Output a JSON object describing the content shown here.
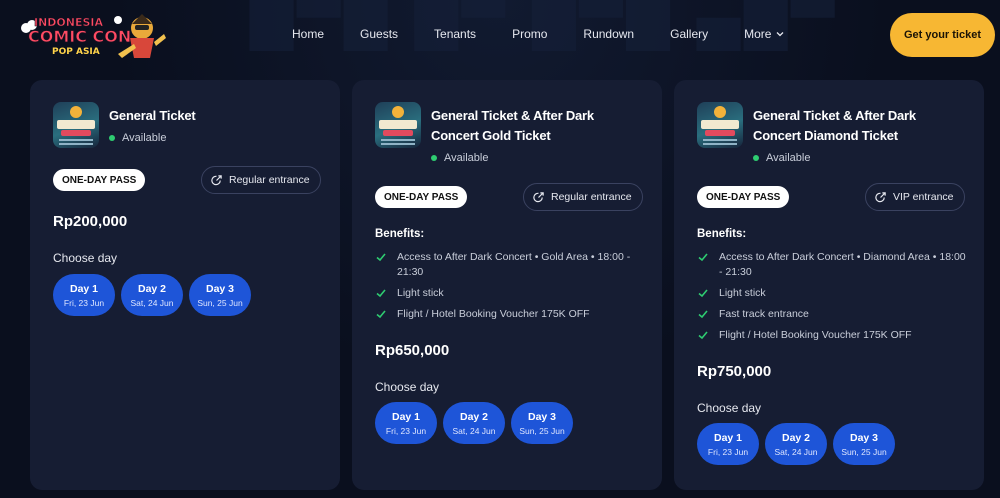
{
  "brand": {
    "logo_line1": "INDONESIA",
    "logo_line2": "COMIC CON",
    "logo_line3": "POP ASIA",
    "accent": "#f7b733",
    "card_bg": "#161d33",
    "day_bg": "#1e55d8",
    "available_color": "#2ecc71"
  },
  "nav": {
    "items": [
      {
        "label": "Home"
      },
      {
        "label": "Guests"
      },
      {
        "label": "Tenants"
      },
      {
        "label": "Promo"
      },
      {
        "label": "Rundown"
      },
      {
        "label": "Gallery"
      },
      {
        "label": "More",
        "icon": "chevron-down-icon"
      }
    ],
    "cta": "Get your ticket"
  },
  "tickets": [
    {
      "title": "General Ticket",
      "status": "Available",
      "pass": "ONE-DAY PASS",
      "entrance": "Regular entrance",
      "price": "Rp200,000",
      "choose_day": "Choose day",
      "days": [
        {
          "day": "Day 1",
          "date": "Fri, 23 Jun"
        },
        {
          "day": "Day 2",
          "date": "Sat, 24 Jun"
        },
        {
          "day": "Day 3",
          "date": "Sun, 25 Jun"
        }
      ]
    },
    {
      "title": "General Ticket & After Dark Concert Gold Ticket",
      "status": "Available",
      "pass": "ONE-DAY PASS",
      "entrance": "Regular entrance",
      "benefits_label": "Benefits:",
      "benefits": [
        "Access to After Dark Concert • Gold Area • 18:00 - 21:30",
        "Light stick",
        "Flight / Hotel Booking Voucher 175K OFF"
      ],
      "price": "Rp650,000",
      "choose_day": "Choose day",
      "days": [
        {
          "day": "Day 1",
          "date": "Fri, 23 Jun"
        },
        {
          "day": "Day 2",
          "date": "Sat, 24 Jun"
        },
        {
          "day": "Day 3",
          "date": "Sun, 25 Jun"
        }
      ]
    },
    {
      "title": "General Ticket & After Dark Concert Diamond Ticket",
      "status": "Available",
      "pass": "ONE-DAY PASS",
      "entrance": "VIP entrance",
      "benefits_label": "Benefits:",
      "benefits": [
        "Access to After Dark Concert • Diamond Area • 18:00 - 21:30",
        "Light stick",
        "Fast track entrance",
        "Flight / Hotel Booking Voucher 175K OFF"
      ],
      "price": "Rp750,000",
      "choose_day": "Choose day",
      "days": [
        {
          "day": "Day 1",
          "date": "Fri, 23 Jun"
        },
        {
          "day": "Day 2",
          "date": "Sat, 24 Jun"
        },
        {
          "day": "Day 3",
          "date": "Sun, 25 Jun"
        }
      ]
    }
  ]
}
